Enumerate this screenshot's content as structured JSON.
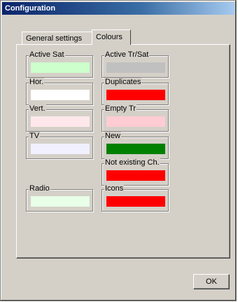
{
  "window": {
    "title": "Configuration"
  },
  "tabs": [
    {
      "label": "General settings",
      "active": false
    },
    {
      "label": "Colours",
      "active": true
    }
  ],
  "colour_settings": [
    {
      "label": "Active Sat",
      "color": "#ccffcc"
    },
    {
      "label": "Active Tr/Sat",
      "color": "#c0c0c0"
    },
    {
      "label": "Hor.",
      "color": "#ffffff"
    },
    {
      "label": "Duplicates",
      "color": "#ff0000"
    },
    {
      "label": "Vert.",
      "color": "#ffe8ec"
    },
    {
      "label": "Empty Tr",
      "color": "#ffccd4"
    },
    {
      "label": "TV",
      "color": "#f0f0ff"
    },
    {
      "label": "New",
      "color": "#008000"
    },
    {
      "label": "Not existing Ch.",
      "color": "#ff0000"
    },
    {
      "label": "Radio",
      "color": "#e8ffe8"
    },
    {
      "label": "Icons",
      "color": "#ff0000"
    }
  ],
  "buttons": {
    "ok_label": "OK"
  }
}
